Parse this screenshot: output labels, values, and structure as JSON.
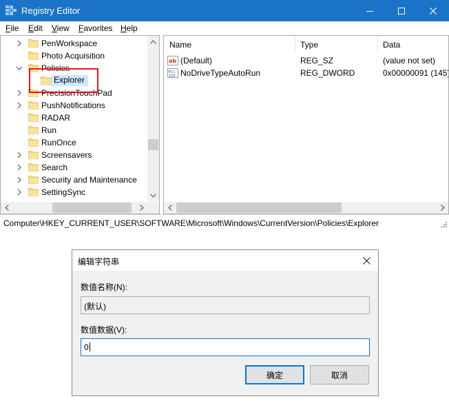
{
  "window": {
    "title": "Registry Editor",
    "colors": {
      "titlebar": "#1a73c6",
      "selection": "#cce8ff",
      "highlight_box": "#e81123"
    }
  },
  "menu": [
    {
      "label": "File",
      "accel": "F",
      "rest": "ile"
    },
    {
      "label": "Edit",
      "accel": "E",
      "rest": "dit"
    },
    {
      "label": "View",
      "accel": "V",
      "rest": "iew"
    },
    {
      "label": "Favorites",
      "accel": "F",
      "rest": "avorites"
    },
    {
      "label": "Help",
      "accel": "H",
      "rest": "elp"
    }
  ],
  "tree": {
    "items": [
      {
        "label": "PenWorkspace",
        "expander": "collapsed"
      },
      {
        "label": "Photo Acquisition",
        "expander": "none"
      },
      {
        "label": "Policies",
        "expander": "expanded"
      },
      {
        "label": "Explorer",
        "expander": "none",
        "selected": true
      },
      {
        "label": "PrecisionTouchPad",
        "expander": "collapsed"
      },
      {
        "label": "PushNotifications",
        "expander": "collapsed"
      },
      {
        "label": "RADAR",
        "expander": "none"
      },
      {
        "label": "Run",
        "expander": "none"
      },
      {
        "label": "RunOnce",
        "expander": "none"
      },
      {
        "label": "Screensavers",
        "expander": "collapsed"
      },
      {
        "label": "Search",
        "expander": "collapsed"
      },
      {
        "label": "Security and Maintenance",
        "expander": "collapsed"
      },
      {
        "label": "SettingSync",
        "expander": "collapsed"
      }
    ]
  },
  "values": {
    "columns": {
      "name": "Name",
      "type": "Type",
      "data": "Data"
    },
    "rows": [
      {
        "icon": "string-value-icon",
        "name": "(Default)",
        "type": "REG_SZ",
        "data": "(value not set)"
      },
      {
        "icon": "binary-value-icon",
        "name": "NoDriveTypeAutoRun",
        "type": "REG_DWORD",
        "data": "0x00000091 (145)"
      }
    ]
  },
  "status": {
    "path": "Computer\\HKEY_CURRENT_USER\\SOFTWARE\\Microsoft\\Windows\\CurrentVersion\\Policies\\Explorer"
  },
  "dialog": {
    "title": "编辑字符串",
    "name_label": "数值名称(N):",
    "name_value": "(默认)",
    "data_label": "数值数据(V):",
    "data_value": "0",
    "ok_label": "确定",
    "cancel_label": "取消"
  }
}
